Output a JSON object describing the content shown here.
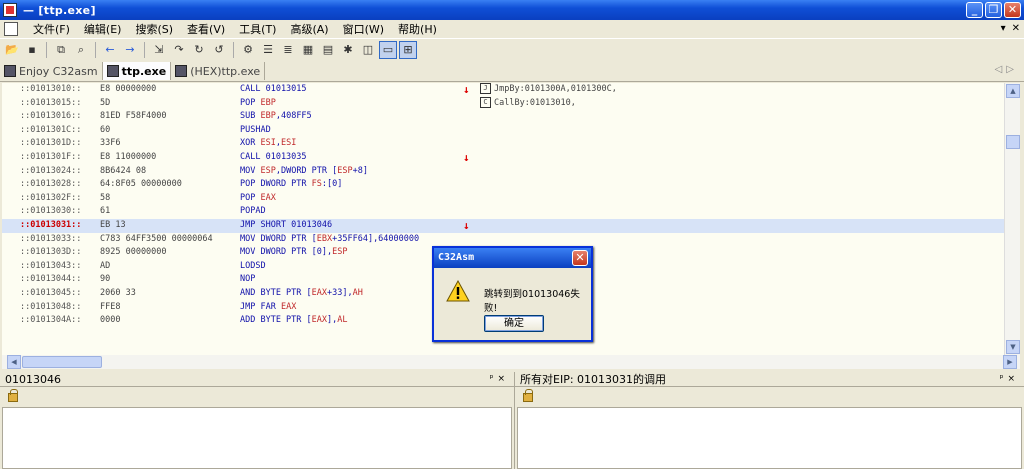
{
  "window": {
    "title": "— [ttp.exe]"
  },
  "menu": {
    "items": [
      "文件(F)",
      "编辑(E)",
      "搜索(S)",
      "查看(V)",
      "工具(T)",
      "高级(A)",
      "窗口(W)",
      "帮助(H)"
    ],
    "mdi_buttons": [
      "▾",
      "✕"
    ]
  },
  "toolbar": {
    "icons": [
      "open-icon",
      "save-icon",
      "copy-icon",
      "find-icon",
      "back-icon",
      "forward-icon",
      "goto-icon",
      "step-icon",
      "jump-icon",
      "return-icon",
      "settings-icon",
      "list-icon",
      "list2-icon",
      "grid-icon",
      "grid2-icon",
      "bug-icon",
      "window-icon",
      "tile-icon"
    ]
  },
  "tabs": [
    {
      "label": "Enjoy C32asm",
      "active": false
    },
    {
      "label": "ttp.exe",
      "active": true
    },
    {
      "label": "(HEX)ttp.exe",
      "active": false
    }
  ],
  "tab_arrows": "◁▷",
  "code": {
    "rows": [
      {
        "addr": "::01013010::",
        "hex": "E8 00000000",
        "asm": "CALL 01013015",
        "mark": "↓",
        "note": "JmpBy:0101300A,0101300C,",
        "note_icon": "J",
        "hl": false
      },
      {
        "addr": "::01013015::",
        "hex": "5D",
        "asm": "POP EBP",
        "mark": "",
        "note": "CallBy:01013010,",
        "note_icon": "C",
        "hl": false
      },
      {
        "addr": "::01013016::",
        "hex": "81ED F58F4000",
        "asm": "SUB EBP,408FF5",
        "mark": "",
        "note": "",
        "note_icon": "",
        "hl": false
      },
      {
        "addr": "::0101301C::",
        "hex": "60",
        "asm": "PUSHAD",
        "mark": "",
        "note": "",
        "note_icon": "",
        "hl": false
      },
      {
        "addr": "::0101301D::",
        "hex": "33F6",
        "asm": "XOR ESI,ESI",
        "mark": "",
        "note": "",
        "note_icon": "",
        "hl": false
      },
      {
        "addr": "::0101301F::",
        "hex": "E8 11000000",
        "asm": "CALL 01013035",
        "mark": "↓",
        "note": "",
        "note_icon": "",
        "hl": false
      },
      {
        "addr": "::01013024::",
        "hex": "8B6424 08",
        "asm": "MOV ESP,DWORD PTR [ESP+8]",
        "mark": "",
        "note": "",
        "note_icon": "",
        "hl": false
      },
      {
        "addr": "::01013028::",
        "hex": "64:8F05 00000000",
        "asm": "POP DWORD PTR FS:[0]",
        "mark": "",
        "note": "",
        "note_icon": "",
        "hl": false
      },
      {
        "addr": "::0101302F::",
        "hex": "58",
        "asm": "POP EAX",
        "mark": "",
        "note": "",
        "note_icon": "",
        "hl": false
      },
      {
        "addr": "::01013030::",
        "hex": "61",
        "asm": "POPAD",
        "mark": "",
        "note": "",
        "note_icon": "",
        "hl": false
      },
      {
        "addr": "::01013031::",
        "hex": "EB 13",
        "asm": "JMP SHORT 01013046",
        "mark": "↓",
        "note": "",
        "note_icon": "",
        "hl": true
      },
      {
        "addr": "::01013033::",
        "hex": "C783 64FF3500 00000064",
        "asm": "MOV DWORD PTR [EBX+35FF64],64000000",
        "mark": "",
        "note": "",
        "note_icon": "",
        "hl": false
      },
      {
        "addr": "::0101303D::",
        "hex": "8925 00000000",
        "asm": "MOV DWORD PTR [0],ESP",
        "mark": "",
        "note": "",
        "note_icon": "",
        "hl": false
      },
      {
        "addr": "::01013043::",
        "hex": "AD",
        "asm": "LODSD",
        "mark": "",
        "note": "",
        "note_icon": "",
        "hl": false
      },
      {
        "addr": "::01013044::",
        "hex": "90",
        "asm": "NOP",
        "mark": "",
        "note": "",
        "note_icon": "",
        "hl": false
      },
      {
        "addr": "::01013045::",
        "hex": "2060 33",
        "asm": "AND BYTE PTR [EAX+33],AH",
        "mark": "",
        "note": "",
        "note_icon": "",
        "hl": false
      },
      {
        "addr": "::01013048::",
        "hex": "FFE8",
        "asm": "JMP FAR EAX",
        "mark": "",
        "note": "",
        "note_icon": "",
        "hl": false
      },
      {
        "addr": "::0101304A::",
        "hex": "0000",
        "asm": "ADD BYTE PTR [EAX],AL",
        "mark": "",
        "note": "",
        "note_icon": "",
        "hl": false
      }
    ]
  },
  "panels": {
    "left": {
      "title": "01013046",
      "buttons": "ᵖ×"
    },
    "right": {
      "title": "所有对EIP: 01013031的调用",
      "buttons": "ᵖ×"
    }
  },
  "dialog": {
    "title": "C32Asm",
    "message": "跳转到到01013046失败!",
    "ok_label": "确定",
    "close_label": "✕"
  }
}
